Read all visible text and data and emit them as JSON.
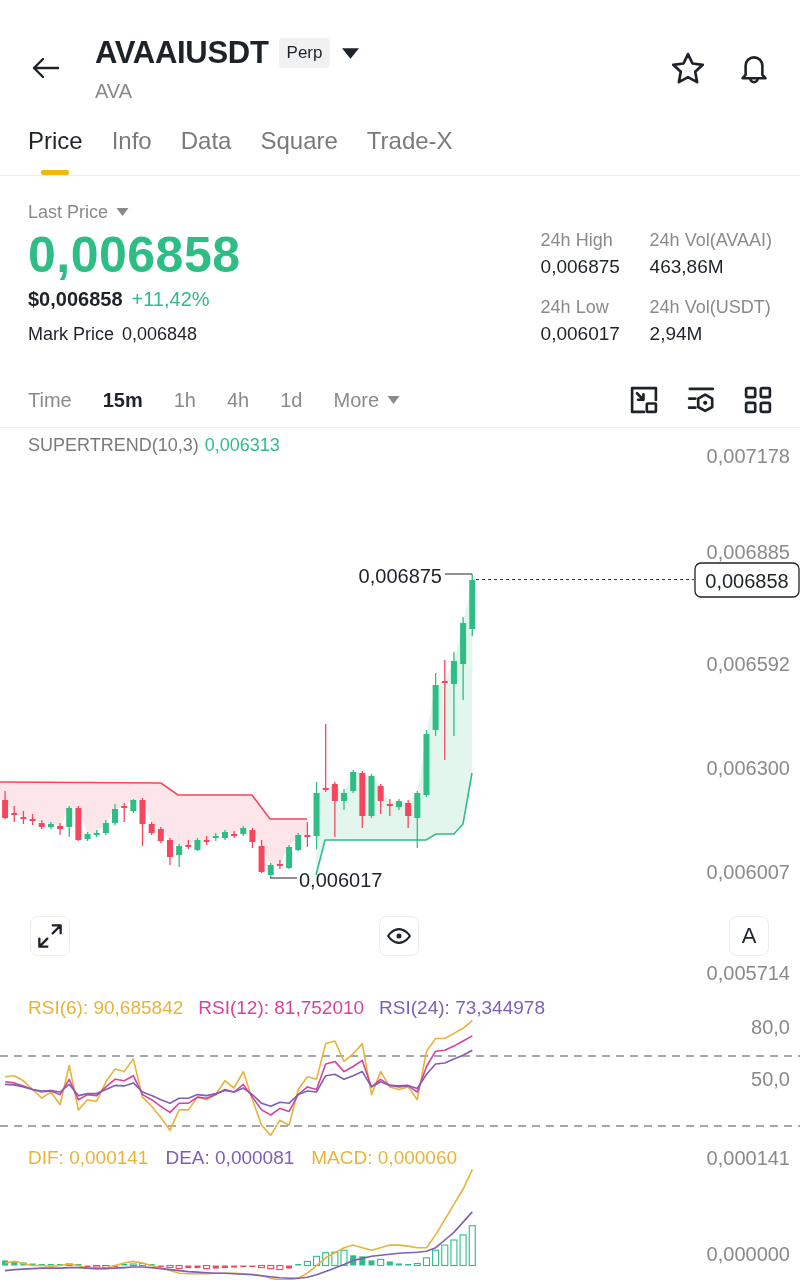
{
  "header": {
    "symbol": "AVAAIUSDT",
    "contract_badge": "Perp",
    "base_asset": "AVA"
  },
  "tabs": [
    {
      "label": "Price",
      "selected": true
    },
    {
      "label": "Info",
      "selected": false
    },
    {
      "label": "Data",
      "selected": false
    },
    {
      "label": "Square",
      "selected": false
    },
    {
      "label": "Trade-X",
      "selected": false
    }
  ],
  "price_summary": {
    "price_type": "Last Price",
    "last_price": "0,006858",
    "usd_price": "$0,006858",
    "change": "+11,42%",
    "mark_price_label": "Mark Price",
    "mark_price": "0,006848"
  },
  "stats": [
    {
      "label": "24h High",
      "value": "0,006875"
    },
    {
      "label": "24h Vol(AVAAI)",
      "value": "463,86M"
    },
    {
      "label": "24h Low",
      "value": "0,006017"
    },
    {
      "label": "24h Vol(USDT)",
      "value": "2,94M"
    }
  ],
  "intervals": [
    {
      "label": "Time",
      "selected": false
    },
    {
      "label": "15m",
      "selected": true
    },
    {
      "label": "1h",
      "selected": false
    },
    {
      "label": "4h",
      "selected": false
    },
    {
      "label": "1d",
      "selected": false
    }
  ],
  "more": "More",
  "chart": {
    "indicator_label": "SUPERTREND(10,3)",
    "indicator_value": "0,006313",
    "price_axis": [
      "0,007178",
      "0,006885",
      "0,006592",
      "0,006300",
      "0,006007",
      "0,005714"
    ],
    "high_label": "0,006875",
    "low_label": "0,006017",
    "last_price_tag": "0,006858",
    "scale_button": "A"
  },
  "rsi": {
    "legend": [
      {
        "text": "RSI(6): 90,685842",
        "color": "#e6b43a"
      },
      {
        "text": "RSI(12): 81,752010",
        "color": "#d6439d"
      },
      {
        "text": "RSI(24): 73,344978",
        "color": "#7e5fb5"
      }
    ],
    "axis": [
      "80,0",
      "50,0"
    ]
  },
  "macd": {
    "legend": [
      {
        "text": "DIF: 0,000141",
        "color": "#e6b43a"
      },
      {
        "text": "DEA: 0,000081",
        "color": "#7e5fb5"
      },
      {
        "text": "MACD: 0,000060",
        "color": "#e6b43a"
      }
    ],
    "axis": [
      "0,000141",
      "0,000000"
    ]
  }
}
